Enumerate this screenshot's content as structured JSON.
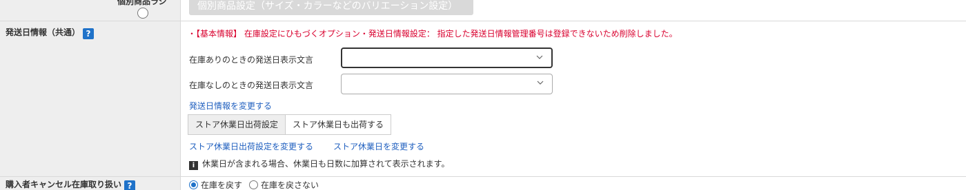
{
  "top_row": {
    "label": "個別商品ラジ",
    "button_label": "個別商品設定（サイズ・カラーなどのバリエーション設定）"
  },
  "shipping": {
    "label": "発送日情報（共通）",
    "help_icon": "?",
    "error_message": "・【基本情報】 在庫設定にひもづくオプション・発送日情報設定： 指定した発送日情報管理番号は登録できないため削除しました。",
    "in_stock_label": "在庫ありのときの発送日表示文言",
    "in_stock_value": "",
    "out_stock_label": "在庫なしのときの発送日表示文言",
    "out_stock_value": "",
    "change_link": "発送日情報を変更する",
    "holiday_key": "ストア休業日出荷設定",
    "holiday_value": "ストア休業日も出荷する",
    "holiday_change_link": "ストア休業日出荷設定を変更する",
    "holiday_days_link": "ストア休業日を変更する",
    "info_icon": "i",
    "info_text": "休業日が含まれる場合、休業日も日数に加算されて表示されます。"
  },
  "cancel": {
    "label": "購入者キャンセル在庫取り扱い",
    "help_icon": "?",
    "options": [
      {
        "label": "在庫を戻す",
        "checked": true
      },
      {
        "label": "在庫を戻さない",
        "checked": false
      }
    ]
  },
  "colors": {
    "accent": "#1f72c9",
    "error": "#d9002e",
    "link": "#1f5fbf"
  }
}
